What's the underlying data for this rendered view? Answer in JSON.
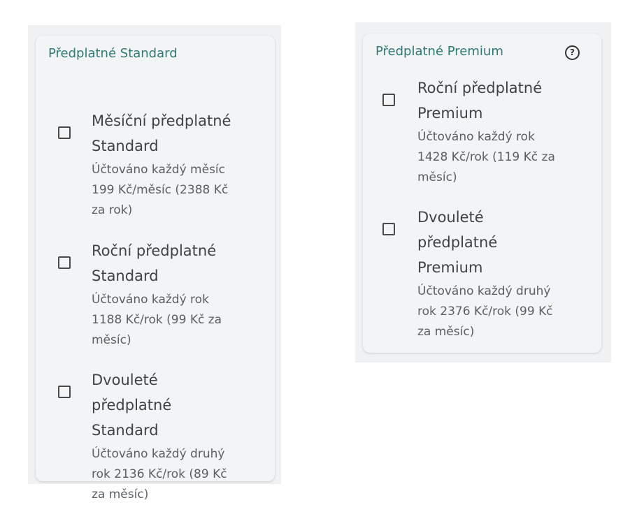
{
  "standard": {
    "title": "Předplatné Standard",
    "options": [
      {
        "title_lines": [
          "Měsíční předplatné",
          "Standard"
        ],
        "desc_lines": [
          "Účtováno každý měsíc",
          "199 Kč/měsíc (2388 Kč",
          "za rok)"
        ]
      },
      {
        "title_lines": [
          "Roční předplatné",
          "Standard"
        ],
        "desc_lines": [
          "Účtováno každý rok",
          "1188 Kč/rok (99 Kč za",
          "měsíc)"
        ]
      },
      {
        "title_lines": [
          "Dvouleté",
          "předplatné",
          "Standard"
        ],
        "desc_lines": [
          "Účtováno každý druhý",
          "rok 2136 Kč/rok (89 Kč",
          "za měsíc)"
        ]
      }
    ]
  },
  "premium": {
    "title": "Předplatné Premium",
    "help_icon": "question-circle-icon",
    "help_glyph": "?",
    "options": [
      {
        "title_lines": [
          "Roční předplatné",
          "Premium"
        ],
        "desc_lines": [
          "Účtováno každý rok",
          "1428 Kč/rok (119 Kč za",
          "měsíc)"
        ]
      },
      {
        "title_lines": [
          "Dvouleté",
          "předplatné",
          "Premium"
        ],
        "desc_lines": [
          "Účtováno každý druhý",
          "rok 2376 Kč/rok (99 Kč",
          "za měsíc)"
        ]
      }
    ]
  }
}
